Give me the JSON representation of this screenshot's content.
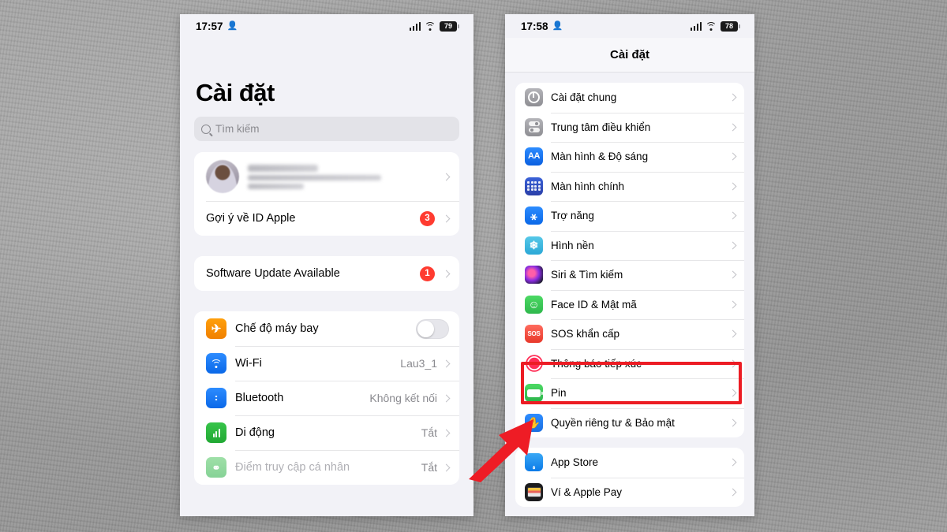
{
  "annotation": {
    "highlight_color": "#ec1c24",
    "arrow_color": "#ee1c25",
    "highlighted_item": "Pin",
    "arrow_name": "red-arrow-pointing-to-pin"
  },
  "phone_left": {
    "status_bar": {
      "time": "17:57",
      "person_icon": "person-icon",
      "signal_icon": "cellular-signal-icon",
      "wifi_icon": "wifi-icon",
      "battery_icon": "battery-icon",
      "battery_level": "79"
    },
    "title": "Cài đặt",
    "search": {
      "placeholder": "Tìm kiếm",
      "icon": "search-icon"
    },
    "account_card": {
      "profile": {
        "name_blurred": true,
        "avatar": "avatar"
      },
      "apple_id_suggestions": {
        "label": "Gợi ý về ID Apple",
        "badge": "3"
      }
    },
    "update_card": {
      "label": "Software Update Available",
      "badge": "1"
    },
    "connectivity": [
      {
        "label": "Chế độ máy bay",
        "icon": "airplane-mode-icon",
        "icon_color": "#ff9f0a",
        "control": "toggle",
        "toggle_on": false
      },
      {
        "label": "Wi-Fi",
        "icon": "wifi-icon",
        "icon_color": "#2d8cff",
        "value": "Lau3_1",
        "control": "chevron"
      },
      {
        "label": "Bluetooth",
        "icon": "bluetooth-icon",
        "icon_color": "#2d8cff",
        "value": "Không kết nối",
        "control": "chevron"
      },
      {
        "label": "Di động",
        "icon": "cellular-icon",
        "icon_color": "#37c44a",
        "value": "Tắt",
        "control": "chevron"
      },
      {
        "label": "Điểm truy cập cá nhân",
        "icon": "personal-hotspot-icon",
        "icon_color": "#9fe0a8",
        "value": "Tắt",
        "control": "chevron",
        "disabled": true
      }
    ]
  },
  "phone_right": {
    "status_bar": {
      "time": "17:58",
      "person_icon": "person-icon",
      "signal_icon": "cellular-signal-icon",
      "wifi_icon": "wifi-icon",
      "battery_icon": "battery-icon",
      "battery_level": "78"
    },
    "nav_title": "Cài đặt",
    "group_system": [
      {
        "label": "Cài đặt chung",
        "icon": "gear-icon",
        "icon_color": "#8e8e93"
      },
      {
        "label": "Trung tâm điều khiển",
        "icon": "control-center-icon",
        "icon_color": "#8e8e93"
      },
      {
        "label": "Màn hình & Độ sáng",
        "icon": "display-brightness-icon",
        "icon_color": "#0a68e8"
      },
      {
        "label": "Màn hình chính",
        "icon": "home-screen-icon",
        "icon_color": "#2a3fa8"
      },
      {
        "label": "Trợ năng",
        "icon": "accessibility-icon",
        "icon_color": "#0a68e8"
      },
      {
        "label": "Hình nền",
        "icon": "wallpaper-icon",
        "icon_color": "#2ba8d6"
      },
      {
        "label": "Siri & Tìm kiếm",
        "icon": "siri-icon",
        "icon_color": "#8a2be2"
      },
      {
        "label": "Face ID & Mật mã",
        "icon": "face-id-icon",
        "icon_color": "#2fb84c"
      },
      {
        "label": "SOS khẩn cấp",
        "icon": "emergency-sos-icon",
        "icon_color": "#e8382a"
      },
      {
        "label": "Thông báo tiếp xúc",
        "icon": "exposure-notification-icon",
        "icon_color": "#ff2d55"
      },
      {
        "label": "Pin",
        "icon": "battery-icon",
        "icon_color": "#2bb34a",
        "highlighted": true
      },
      {
        "label": "Quyền riêng tư & Bảo mật",
        "icon": "privacy-security-icon",
        "icon_color": "#1b6fe0"
      }
    ],
    "group_store": [
      {
        "label": "App Store",
        "icon": "app-store-icon",
        "icon_color": "#0a7ae8"
      },
      {
        "label": "Ví & Apple Pay",
        "icon": "wallet-icon",
        "icon_color": "#1c1c1e"
      }
    ]
  }
}
